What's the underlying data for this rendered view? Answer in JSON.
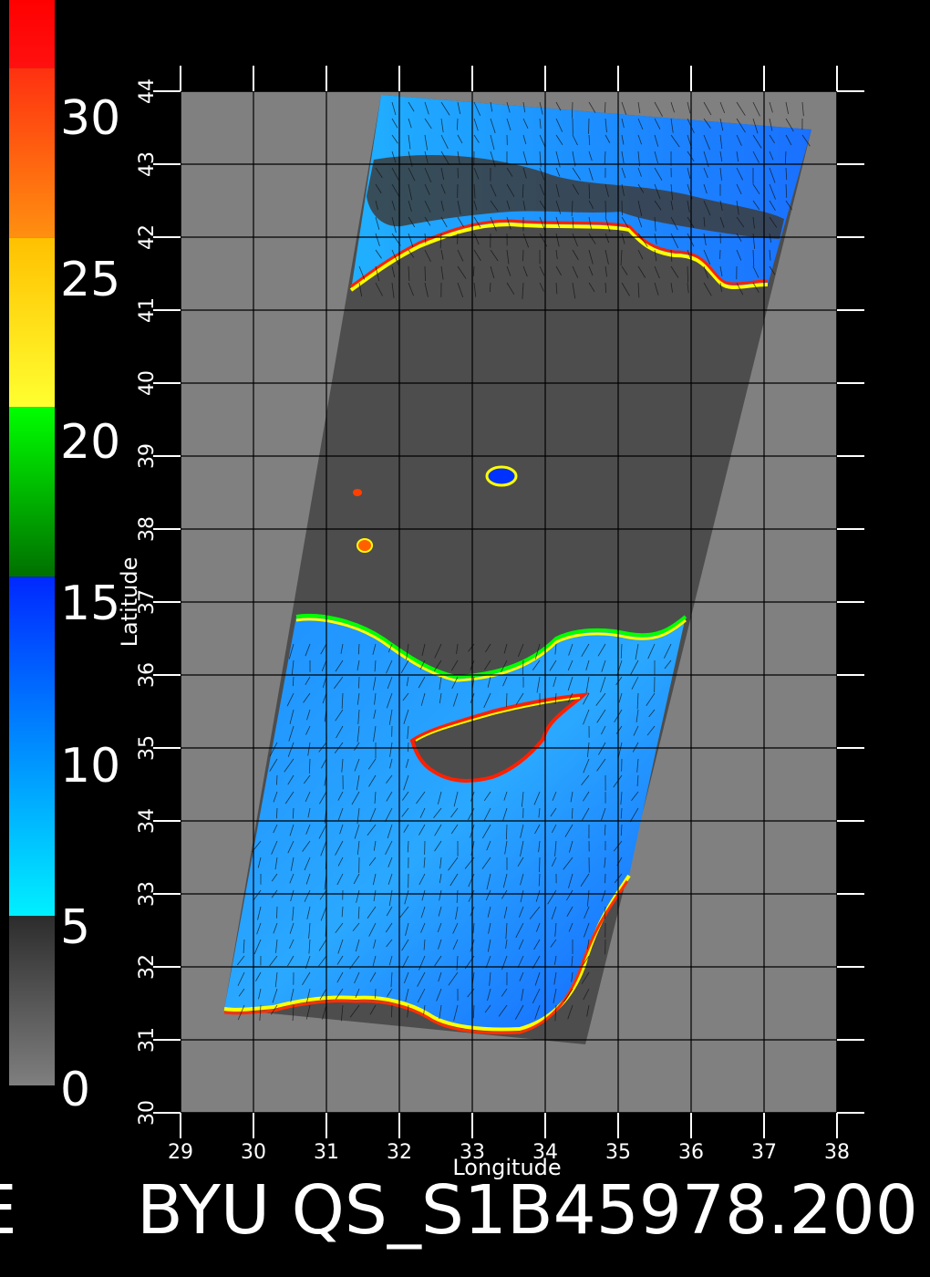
{
  "title": "BYU QS_S1B45978.200",
  "title_prefix": "E",
  "colorbar": {
    "labels": [
      "0",
      "5",
      "10",
      "15",
      "20",
      "25",
      "30"
    ],
    "stops": [
      {
        "from": 0,
        "to": 5,
        "colors": [
          "#7f7f7f",
          "#2c2c2c"
        ]
      },
      {
        "from": 5,
        "to": 15,
        "colors": [
          "#00f0ff",
          "#0028ff"
        ]
      },
      {
        "from": 15,
        "to": 20,
        "colors": [
          "#007000",
          "#00ff00"
        ]
      },
      {
        "from": 20,
        "to": 25,
        "colors": [
          "#ffff30",
          "#ffc000"
        ]
      },
      {
        "from": 25,
        "to": 30,
        "colors": [
          "#ff9010",
          "#ff3010"
        ]
      },
      {
        "from": 30,
        "to": 32,
        "colors": [
          "#ff1010",
          "#ff0000"
        ]
      }
    ]
  },
  "map": {
    "xlabel": "Longitude",
    "ylabel": "Latitude",
    "x_ticks": [
      "29",
      "30",
      "31",
      "32",
      "33",
      "34",
      "35",
      "36",
      "37",
      "38"
    ],
    "y_ticks": [
      "30",
      "31",
      "32",
      "33",
      "34",
      "35",
      "36",
      "37",
      "38",
      "39",
      "40",
      "41",
      "42",
      "43",
      "44"
    ],
    "lon_range": [
      29,
      38
    ],
    "lat_range": [
      30,
      44
    ],
    "colors": {
      "land": "#4d4d4d",
      "background": "#808080",
      "sea_low": "#00c8ff",
      "sea_high": "#0032ff",
      "coast_edge": [
        "#00ff00",
        "#ffff00",
        "#ff8000",
        "#ff0000",
        "#ff00ff"
      ]
    }
  }
}
